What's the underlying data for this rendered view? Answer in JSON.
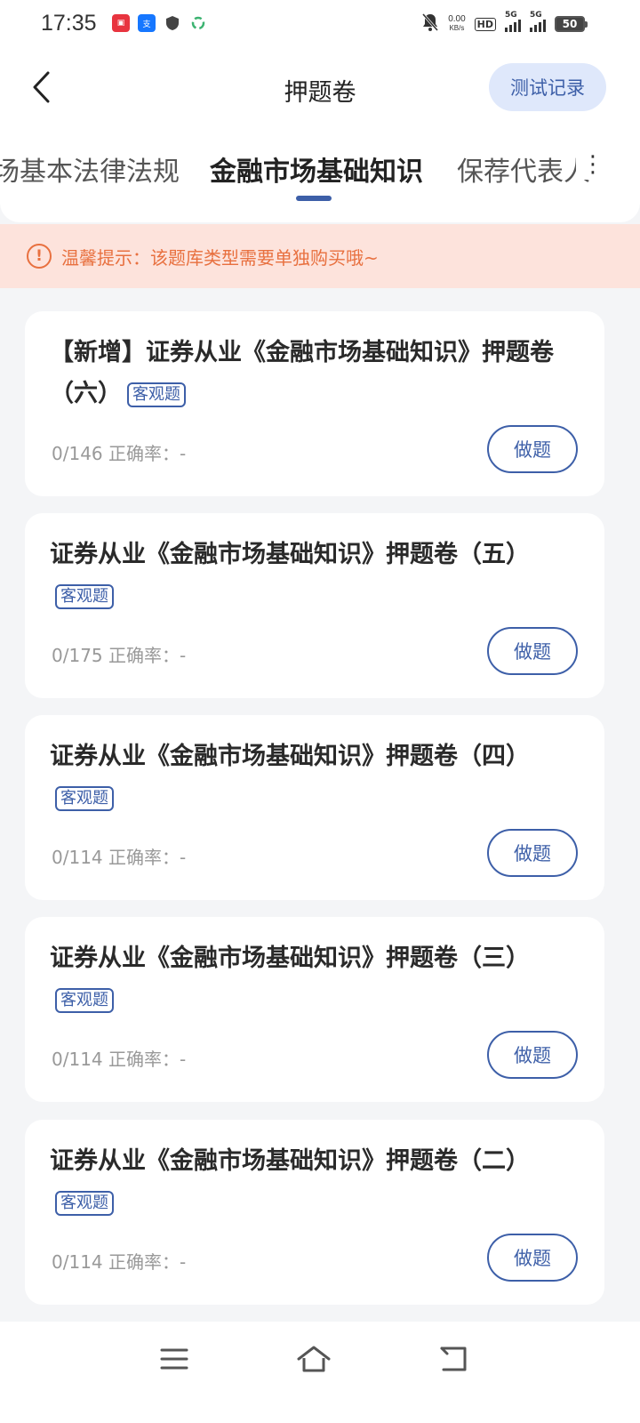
{
  "status_bar": {
    "time": "17:35",
    "net_speed_value": "0.00",
    "net_speed_unit": "KB/s",
    "hd_label": "HD",
    "signal1_label": "5G",
    "signal2_label": "5G",
    "battery": "50",
    "left_icons": [
      "news-app-icon",
      "alipay-icon",
      "shield-icon",
      "recycle-icon"
    ]
  },
  "header": {
    "title": "押题卷",
    "record_button": "测试记录"
  },
  "tabs": {
    "items": [
      {
        "label": "场基本法律法规",
        "active": false
      },
      {
        "label": "金融市场基础知识",
        "active": true
      },
      {
        "label": "保荐代表人",
        "active": false
      }
    ],
    "more": "⋮"
  },
  "notice": {
    "icon_glyph": "!",
    "text": "温馨提示：该题库类型需要单独购买哦~"
  },
  "papers": [
    {
      "title": "【新增】证券从业《金融市场基础知识》押题卷（六）",
      "tag": "客观题",
      "stats": "0/146 正确率：-",
      "action": "做题"
    },
    {
      "title": "证券从业《金融市场基础知识》押题卷（五）",
      "tag": "客观题",
      "stats": "0/175 正确率：-",
      "action": "做题"
    },
    {
      "title": "证券从业《金融市场基础知识》押题卷（四）",
      "tag": "客观题",
      "stats": "0/114 正确率：-",
      "action": "做题"
    },
    {
      "title": "证券从业《金融市场基础知识》押题卷（三）",
      "tag": "客观题",
      "stats": "0/114 正确率：-",
      "action": "做题"
    },
    {
      "title": "证券从业《金融市场基础知识》押题卷（二）",
      "tag": "客观题",
      "stats": "0/114 正确率：-",
      "action": "做题"
    }
  ],
  "colors": {
    "accent": "#3d5fa8",
    "notice_bg": "#fde3dc",
    "notice_text": "#e8703f",
    "page_bg": "#f4f5f7"
  },
  "nav_bar": [
    "menu-icon",
    "home-icon",
    "back-icon"
  ]
}
